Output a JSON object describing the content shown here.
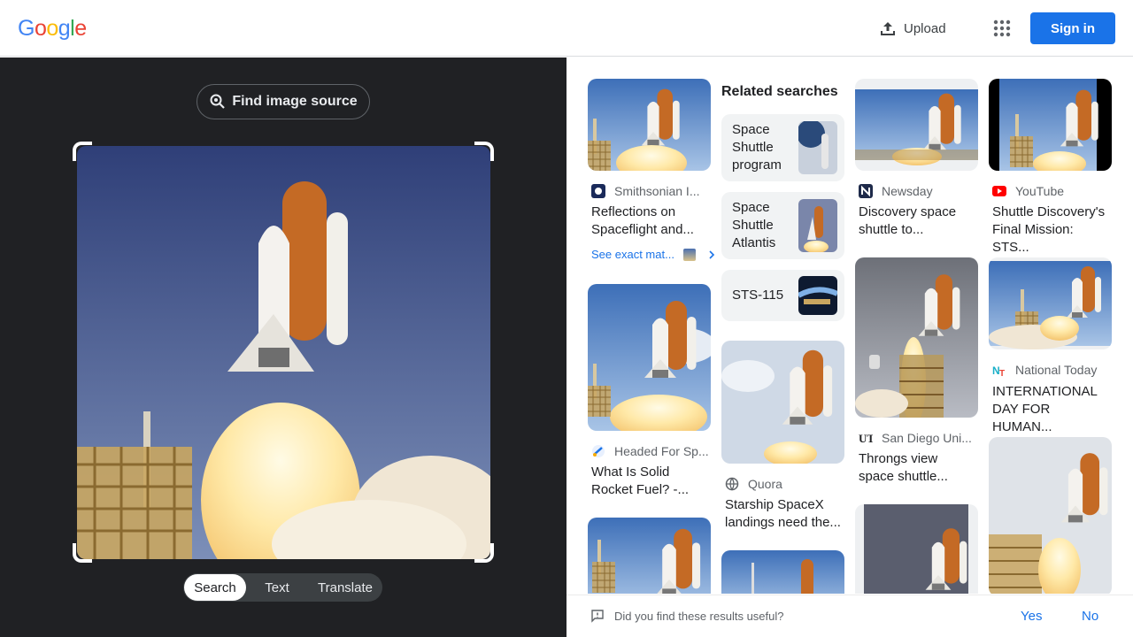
{
  "header": {
    "logo_letters": [
      "G",
      "o",
      "o",
      "g",
      "l",
      "e"
    ],
    "logo_colors": [
      "#4285F4",
      "#EA4335",
      "#FBBC05",
      "#4285F4",
      "#34A853",
      "#EA4335"
    ],
    "upload_label": "Upload",
    "apps_icon": "apps-grid-icon",
    "signin_label": "Sign in"
  },
  "left_panel": {
    "find_source_label": "Find image source",
    "modes": [
      "Search",
      "Text",
      "Translate"
    ],
    "active_mode": "Search"
  },
  "results": {
    "col1": [
      {
        "source": "Smithsonian I...",
        "title1": "Reflections on",
        "title2": "Spaceflight and...",
        "favicon": "smithsonian-icon"
      },
      {
        "source": "Headed For Sp...",
        "title1": "What Is Solid",
        "title2": "Rocket Fuel? -...",
        "favicon": "rocket-icon"
      }
    ],
    "see_exact": "See exact mat...",
    "related": {
      "heading": "Related searches",
      "chips": [
        {
          "lines": [
            "Space",
            "Shuttle",
            "program"
          ]
        },
        {
          "lines": [
            "Space",
            "Shuttle",
            "Atlantis"
          ]
        },
        {
          "lines": [
            "STS-115"
          ]
        }
      ]
    },
    "col2": [
      {
        "source": "Quora",
        "title1": "Starship SpaceX",
        "title2": "landings need the...",
        "favicon": "globe-icon"
      }
    ],
    "col3": [
      {
        "source": "Newsday",
        "title1": "Discovery space",
        "title2": "shuttle to...",
        "favicon": "newsday-icon"
      },
      {
        "source": "San Diego Uni...",
        "title1": "Throngs view",
        "title2": "space shuttle...",
        "favicon": "ut-icon"
      }
    ],
    "col4": [
      {
        "source": "YouTube",
        "title1": "Shuttle Discovery's",
        "title2": "Final Mission: STS...",
        "favicon": "youtube-icon"
      },
      {
        "source": "National Today",
        "title1": "INTERNATIONAL",
        "title2": "DAY FOR HUMAN...",
        "favicon": "nt-icon"
      }
    ]
  },
  "feedback": {
    "question": "Did you find these results useful?",
    "yes": "Yes",
    "no": "No"
  }
}
